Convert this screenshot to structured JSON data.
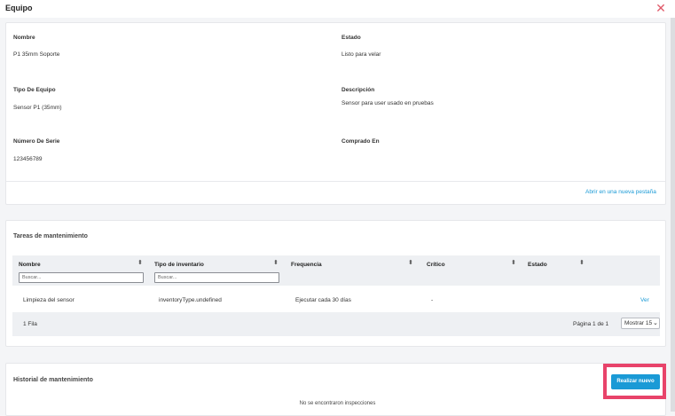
{
  "modal": {
    "title": "Equipo"
  },
  "details": {
    "nombre_label": "Nombre",
    "nombre_value": "P1 35mm Soporte",
    "estado_label": "Estado",
    "estado_value": "Listo para velar",
    "tipo_label": "Tipo De Equipo",
    "tipo_value": "Sensor P1 (35mm)",
    "descripcion_label": "Descripción",
    "descripcion_value": "Sensor para user usado en pruebas",
    "serie_label": "Número De Serie",
    "serie_value": "123456789",
    "comprado_label": "Comprado En",
    "open_link": "Abrir en una nueva pestaña"
  },
  "tareas": {
    "title": "Tareas de mantenimiento",
    "columns": [
      "Nombre",
      "Tipo de inventario",
      "Frequencia",
      "Crítico",
      "Estado"
    ],
    "filter_placeholder": "Buscar...",
    "rows": [
      {
        "nombre": "Limpieza del sensor",
        "tipo": "inventoryType.undefined",
        "frecuencia": "Ejecutar cada 30 días",
        "critico": "-",
        "action": "Ver"
      }
    ],
    "footer": {
      "count": "1 Fila",
      "page": "Página 1 de 1",
      "show": "Mostrar 15"
    }
  },
  "historial": {
    "title": "Historial de mantenimiento",
    "button": "Realizar nuevo",
    "empty": "No se encontraron inspecciones"
  },
  "colors": {
    "accent": "#1a9ad6",
    "highlight": "#e8436a",
    "close": "#e05a6a"
  },
  "icons": {
    "close": "close-icon",
    "sort": "sort-arrows-icon",
    "chevron": "chevron-down-icon"
  }
}
